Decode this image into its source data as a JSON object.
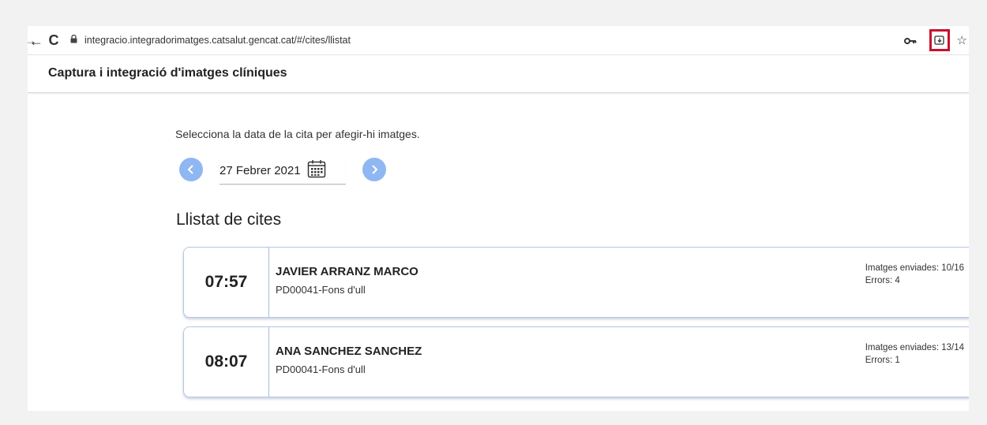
{
  "browser": {
    "url": "integracio.integradorimatges.catsalut.gencat.cat/#/cites/llistat",
    "back_glyph": "←",
    "forward_glyph": "→",
    "reload_glyph": "C",
    "lock_glyph": "🔒",
    "key_glyph": "o━",
    "star_glyph": "☆",
    "highlight_color": "#c8102e"
  },
  "header": {
    "title": "Captura i integració d'imatges clíniques"
  },
  "date_picker": {
    "instruction": "Selecciona la data de la cita per afegir-hi imatges.",
    "date": "27 Febrer 2021",
    "prev_glyph": "‹",
    "next_glyph": "›",
    "arrow_color": "#8fb7f2"
  },
  "appointments": {
    "title": "Llistat de cites",
    "items": [
      {
        "time": "07:57",
        "patient": "JAVIER ARRANZ MARCO",
        "procedure": "PD00041-Fons d'ull",
        "images_sent": "Imatges enviades: 10/16",
        "errors": "Errors: 4"
      },
      {
        "time": "08:07",
        "patient": "ANA SANCHEZ SANCHEZ",
        "procedure": "PD00041-Fons d'ull",
        "images_sent": "Imatges enviades: 13/14",
        "errors": "Errors: 1"
      }
    ]
  }
}
